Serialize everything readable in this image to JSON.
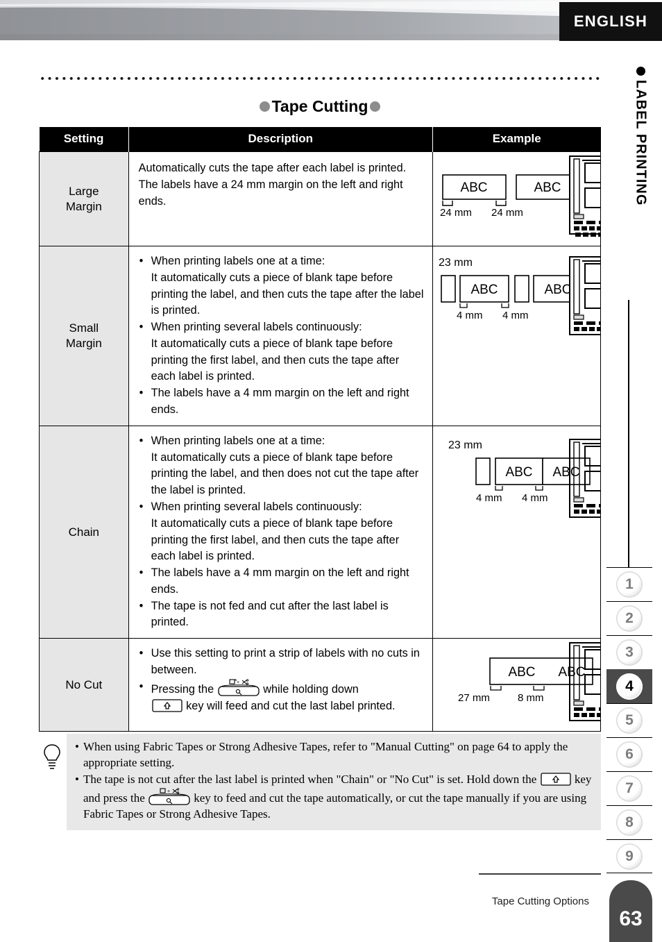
{
  "header": {
    "language_tab": "ENGLISH"
  },
  "section": {
    "title": "Tape Cutting"
  },
  "table": {
    "columns": [
      "Setting",
      "Description",
      "Example"
    ],
    "rows": [
      {
        "setting": "Large\nMargin",
        "description_type": "plain",
        "description": "Automatically cuts the tape after each label is printed. The labels have a 24 mm margin on the left and right ends.",
        "example": {
          "top_label": "",
          "measures": [
            "24 mm",
            "24 mm"
          ],
          "label_text": [
            "ABC",
            "ABC"
          ]
        }
      },
      {
        "setting": "Small\nMargin",
        "description_type": "bullets",
        "bullets": [
          "When printing labels one at a time:\nIt automatically cuts a piece of blank tape before printing the label, and then cuts the tape after the label is printed.",
          "When printing several labels continuously:\nIt automatically cuts a piece of blank tape before printing the first label, and then cuts the tape after each label is printed.",
          "The labels have a 4 mm margin on the left and right ends."
        ],
        "example": {
          "top_label": "23 mm",
          "measures": [
            "4 mm",
            "4 mm"
          ],
          "label_text": [
            "ABC",
            "ABC"
          ]
        }
      },
      {
        "setting": "Chain",
        "description_type": "bullets",
        "bullets": [
          "When printing labels one at a time:\nIt automatically cuts a piece of blank tape before printing the label, and then does not cut the tape after the label is printed.",
          "When printing several labels continuously:\nIt automatically cuts a piece of blank tape before printing the first label, and then cuts the tape after each label is printed.",
          "The labels have a 4 mm margin on the left and right ends.",
          "The tape is not fed and cut after the last label is printed."
        ],
        "example": {
          "top_label": "23 mm",
          "measures": [
            "4 mm",
            "4 mm"
          ],
          "label_text": [
            "ABC",
            "ABC"
          ]
        }
      },
      {
        "setting": "No Cut",
        "description_type": "keys",
        "bullets": [
          "Use this setting to print a strip of labels with no cuts in between."
        ],
        "key_bullet": {
          "part1": "Pressing the",
          "part2": "while holding down",
          "part3": "key will feed and cut the last label printed."
        },
        "example": {
          "top_label": "",
          "measures": [
            "27 mm",
            "8 mm"
          ],
          "label_text": [
            "ABC",
            "ABC"
          ]
        }
      }
    ]
  },
  "note": {
    "items": [
      {
        "type": "text",
        "text": "When using Fabric Tapes or Strong Adhesive Tapes, refer to \"Manual Cutting\" on page 64 to apply the appropriate setting."
      },
      {
        "type": "keys",
        "part1": "The tape is not cut after the last label is printed when \"Chain\" or \"No Cut\" is set. Hold down the",
        "part2": "key and press the",
        "part3": "key to feed and cut the tape automatically, or cut the tape manually if you are using Fabric Tapes or Strong Adhesive Tapes."
      }
    ]
  },
  "sidebar": {
    "vertical_title": "LABEL PRINTING",
    "chapters": [
      "1",
      "2",
      "3",
      "4",
      "5",
      "6",
      "7",
      "8",
      "9"
    ],
    "active_chapter": "4"
  },
  "footer": {
    "section_name": "Tape Cutting Options",
    "page_number": "63"
  },
  "icons": {
    "tip": "lightbulb-icon",
    "feed_cut_key": "feed-and-cut-key-icon",
    "shift_key": "shift-key-icon"
  },
  "colors": {
    "header_tab_bg": "#111111",
    "table_header_bg": "#000000",
    "setting_cell_bg": "#e6e6e6",
    "note_bg": "#e8e8e8",
    "active_tab_bg": "#4a4a4a",
    "title_dot": "#8d8d8d"
  }
}
